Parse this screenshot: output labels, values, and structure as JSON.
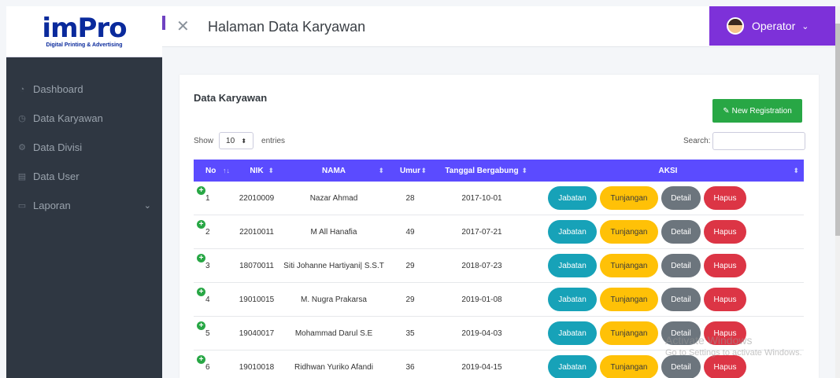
{
  "logo": {
    "main": "imPro",
    "sub": "Digital Printing & Advertising"
  },
  "sidebar": {
    "items": [
      {
        "label": "Dashboard",
        "icon": "dashboard-icon"
      },
      {
        "label": "Data Karyawan",
        "icon": "clock-icon"
      },
      {
        "label": "Data Divisi",
        "icon": "gear-icon"
      },
      {
        "label": "Data User",
        "icon": "calendar-icon"
      },
      {
        "label": "Laporan",
        "icon": "folder-icon"
      }
    ]
  },
  "header": {
    "title": "Halaman Data Karyawan",
    "user": "Operator"
  },
  "card": {
    "title": "Data Karyawan",
    "new_button": "New Registration",
    "show_label": "Show",
    "entries_value": "10",
    "entries_label": "entries",
    "search_label": "Search:"
  },
  "table": {
    "columns": [
      "No",
      "NIK",
      "NAMA",
      "Umur",
      "Tanggal Bergabung",
      "AKSI"
    ],
    "rows": [
      {
        "no": "1",
        "nik": "22010009",
        "nama": "Nazar Ahmad",
        "umur": "28",
        "tanggal": "2017-10-01"
      },
      {
        "no": "2",
        "nik": "22010011",
        "nama": "M All Hanafia",
        "umur": "49",
        "tanggal": "2017-07-21"
      },
      {
        "no": "3",
        "nik": "18070011",
        "nama": "Siti Johanne Hartiyani| S.S.T",
        "umur": "29",
        "tanggal": "2018-07-23"
      },
      {
        "no": "4",
        "nik": "19010015",
        "nama": "M. Nugra Prakarsa",
        "umur": "29",
        "tanggal": "2019-01-08"
      },
      {
        "no": "5",
        "nik": "19040017",
        "nama": "Mohammad Darul S.E",
        "umur": "35",
        "tanggal": "2019-04-03"
      },
      {
        "no": "6",
        "nik": "19010018",
        "nama": "Ridhwan Yuriko Afandi",
        "umur": "36",
        "tanggal": "2019-04-15"
      }
    ],
    "actions": {
      "jabatan": "Jabatan",
      "tunjangan": "Tunjangan",
      "detail": "Detail",
      "hapus": "Hapus"
    }
  },
  "watermark": {
    "line1": "Activate Windows",
    "line2": "Go to Settings to activate Windows."
  },
  "colors": {
    "sidebar": "#2f3742",
    "accent": "#7d31d9",
    "table_header": "#5b4bff",
    "success": "#28a745"
  }
}
